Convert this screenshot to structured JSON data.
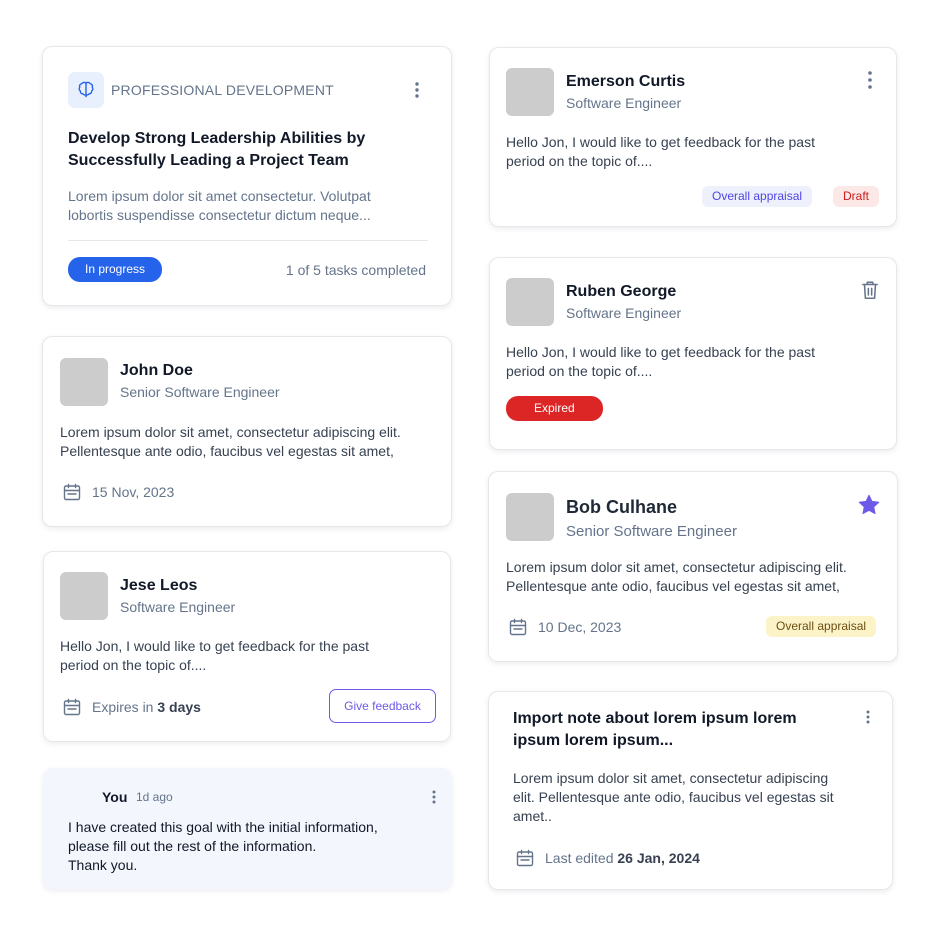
{
  "goal_card": {
    "category": "PROFESSIONAL DEVELOPMENT",
    "title": "Develop Strong Leadership Abilities by Successfully Leading a Project Team",
    "description": "Lorem ipsum dolor sit amet consectetur. Volutpat lobortis suspendisse consectetur dictum neque...",
    "status": "In progress",
    "progress_text": "1 of 5 tasks completed",
    "progress_fraction": 0.2
  },
  "john_card": {
    "name": "John Doe",
    "role": "Senior Software Engineer",
    "text": "Lorem ipsum dolor sit amet, consectetur adipiscing elit. Pellentesque ante odio, faucibus vel egestas sit amet,",
    "date": "15 Nov, 2023"
  },
  "jese_card": {
    "name": "Jese Leos",
    "role": "Software Engineer",
    "text": "Hello Jon, I would like to get feedback for the past period on the topic of....",
    "expires_prefix": "Expires in",
    "expires_value": "3 days",
    "button": "Give feedback"
  },
  "comment_card": {
    "author": "You",
    "time": "1d ago",
    "lines": [
      "I have created this goal with the initial information,",
      "please fill out the rest of the information.",
      "Thank you."
    ]
  },
  "emerson_card": {
    "name": "Emerson Curtis",
    "role": "Software Engineer",
    "text": "Hello Jon, I would like to get feedback for the past period on the topic of....",
    "badge1": "Overall appraisal",
    "badge2": "Draft"
  },
  "ruben_card": {
    "name": "Ruben George",
    "role": "Software Engineer",
    "text": "Hello Jon, I would like to get feedback for the past period on the topic of....",
    "status": "Expired"
  },
  "bob_card": {
    "name": "Bob Culhane",
    "role": "Senior Software Engineer",
    "text": "Lorem ipsum dolor sit amet, consectetur adipiscing elit. Pellentesque ante odio, faucibus vel egestas sit amet,",
    "date": "10 Dec, 2023",
    "badge": "Overall appraisal"
  },
  "note_card": {
    "title": "Import note about lorem ipsum lorem ipsum lorem ipsum...",
    "text": "Lorem ipsum dolor sit amet, consectetur adipiscing elit. Pellentesque ante odio, faucibus vel egestas sit amet..",
    "edited_prefix": "Last edited",
    "edited_date": "26 Jan, 2024"
  },
  "colors": {
    "accent": "#2563eb",
    "expired": "#dc2626",
    "star": "#6d5ae8",
    "badge_purple_bg": "#eef0fb",
    "badge_red_bg": "#fde8e8",
    "badge_yellow_bg": "#fdf3c9"
  }
}
